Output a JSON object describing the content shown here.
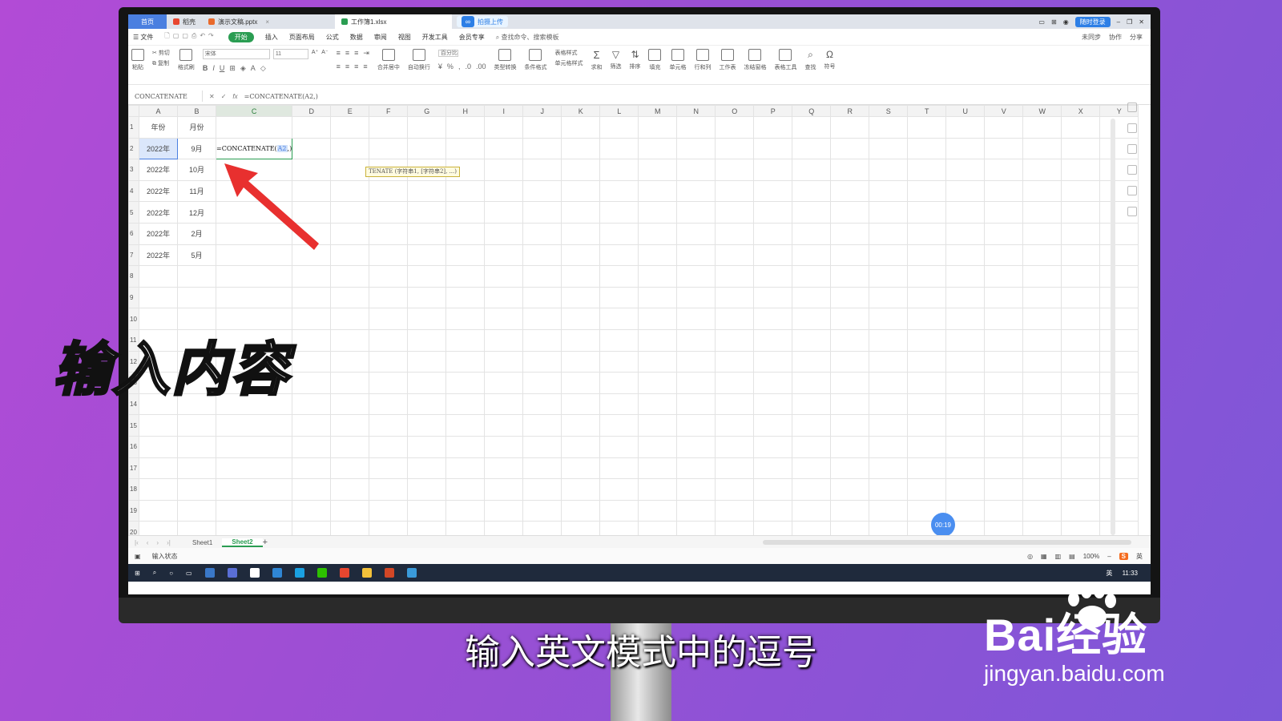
{
  "browser_tabs": [
    {
      "label": "首页",
      "type": "home"
    },
    {
      "label": "稻壳",
      "type": "docer"
    },
    {
      "label": "演示文稿.pptx",
      "type": "ppt"
    },
    {
      "label": "工作簿1.xlsx",
      "type": "xlsx",
      "active": true
    }
  ],
  "upload_label": "拍摄上传",
  "titlebar_right": {
    "login_label": "随时登录"
  },
  "menu": {
    "file": "文件",
    "items": [
      "开始",
      "插入",
      "页面布局",
      "公式",
      "数据",
      "审阅",
      "视图",
      "开发工具",
      "会员专享"
    ],
    "search_placeholder": "查找命令、搜索模板",
    "right": [
      "未同步",
      "协作",
      "分享"
    ]
  },
  "ribbon": {
    "paste": "粘贴",
    "cut": "剪切",
    "copy": "复制",
    "format_painter": "格式刷",
    "font_name": "宋体",
    "font_size": "11",
    "merge": "合并居中",
    "wrap": "自动换行",
    "number_format": "百分比",
    "type_convert": "类型转换",
    "cond_format": "条件格式",
    "table_style": "表格样式",
    "cell_style": "单元格样式",
    "sum": "求和",
    "filter": "筛选",
    "sort": "排序",
    "fill": "填充",
    "cell": "单元格",
    "row_col": "行和列",
    "worksheet": "工作表",
    "freeze": "冻结窗格",
    "table_tools": "表格工具",
    "find": "查找",
    "symbol": "符号"
  },
  "formula_bar": {
    "name_box": "CONCATENATE",
    "fx_label": "fx",
    "formula": "=CONCATENATE(A2,)"
  },
  "columns": [
    "A",
    "B",
    "C",
    "D",
    "E",
    "F",
    "G",
    "H",
    "I",
    "J",
    "K",
    "L",
    "M",
    "N",
    "O",
    "P",
    "Q",
    "R",
    "S",
    "T",
    "U",
    "V",
    "W",
    "X",
    "Y"
  ],
  "rows": [
    {
      "n": "1",
      "a": "年份",
      "b": "月份"
    },
    {
      "n": "2",
      "a": "2022年",
      "b": "9月"
    },
    {
      "n": "3",
      "a": "2022年",
      "b": "10月"
    },
    {
      "n": "4",
      "a": "2022年",
      "b": "11月"
    },
    {
      "n": "5",
      "a": "2022年",
      "b": "12月"
    },
    {
      "n": "6",
      "a": "2022年",
      "b": "2月"
    },
    {
      "n": "7",
      "a": "2022年",
      "b": "5月"
    },
    {
      "n": "8"
    },
    {
      "n": "9"
    },
    {
      "n": "10"
    },
    {
      "n": "11"
    },
    {
      "n": "12"
    },
    {
      "n": "13"
    },
    {
      "n": "14"
    },
    {
      "n": "15"
    },
    {
      "n": "16"
    },
    {
      "n": "17"
    },
    {
      "n": "18"
    },
    {
      "n": "19"
    },
    {
      "n": "20"
    }
  ],
  "active_cell_editor": {
    "prefix": "=CONCATENATE(",
    "ref": "A2",
    "suffix": ",)"
  },
  "function_tooltip": "TENATE (字符串1, [字符串2], ...)",
  "sheets": [
    "Sheet1",
    "Sheet2"
  ],
  "active_sheet": "Sheet2",
  "status": {
    "mode": "输入状态",
    "zoom": "100%",
    "ime": "英"
  },
  "taskbar": {
    "time": "11:33",
    "ime": "英"
  },
  "timer": "00:19",
  "overlay": {
    "caption": "输入内容",
    "subtitle": "输入英文模式中的逗号",
    "watermark_logo": "Bai经验",
    "watermark_url": "jingyan.baidu.com"
  },
  "colors": {
    "accent_green": "#2a9d52",
    "accent_blue": "#4a7fe0",
    "arrow_red": "#e8302f",
    "background": "#9a4fd4"
  }
}
